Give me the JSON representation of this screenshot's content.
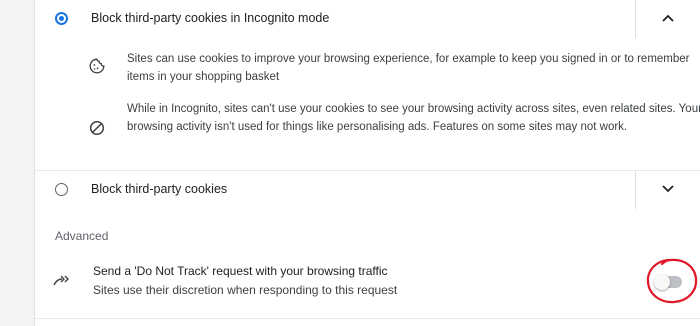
{
  "cookie_options": {
    "incognito": {
      "label": "Block third-party cookies in Incognito mode",
      "selected": true,
      "expanded": true,
      "details": [
        {
          "icon": "cookie-icon",
          "text": "Sites can use cookies to improve your browsing experience, for example to keep you signed in or to remember items in your shopping basket"
        },
        {
          "icon": "block-icon",
          "text": "While in Incognito, sites can't use your cookies to see your browsing activity across sites, even related sites. Your browsing activity isn't used for things like personalising ads. Features on some sites may not work."
        }
      ]
    },
    "block_third_party": {
      "label": "Block third-party cookies",
      "selected": false,
      "expanded": false
    }
  },
  "advanced": {
    "heading": "Advanced",
    "do_not_track": {
      "icon": "do-not-track-icon",
      "title": "Send a 'Do Not Track' request with your browsing traffic",
      "subtitle": "Sites use their discretion when responding to this request",
      "enabled": false
    }
  },
  "colors": {
    "accent": "#1a73e8",
    "annotation": "#e0182a",
    "toggle_track_off": "#bdc1c6"
  }
}
